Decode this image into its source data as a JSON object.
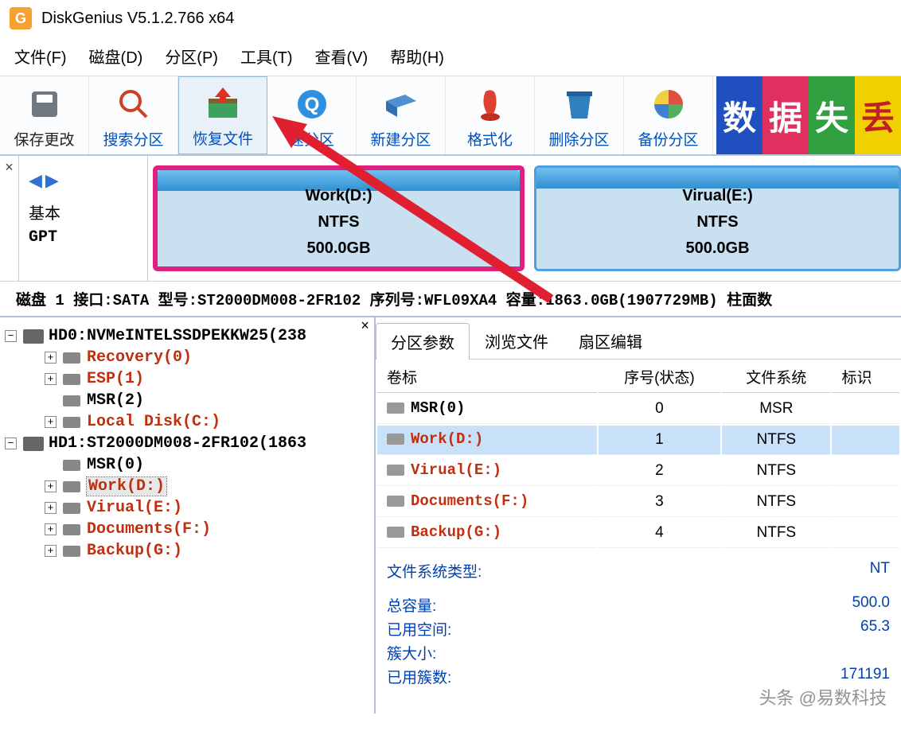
{
  "title": "DiskGenius V5.1.2.766 x64",
  "menu": [
    "文件(F)",
    "磁盘(D)",
    "分区(P)",
    "工具(T)",
    "查看(V)",
    "帮助(H)"
  ],
  "toolbar": [
    "保存更改",
    "搜索分区",
    "恢复文件",
    "速分区",
    "新建分区",
    "格式化",
    "删除分区",
    "备份分区"
  ],
  "ad": [
    "数",
    "据",
    "失",
    "丢"
  ],
  "nav": {
    "basic": "基本",
    "gpt": "GPT"
  },
  "partitions": [
    {
      "name": "Work(D:)",
      "fs": "NTFS",
      "size": "500.0GB",
      "selected": true
    },
    {
      "name": "Virual(E:)",
      "fs": "NTFS",
      "size": "500.0GB",
      "selected": false
    }
  ],
  "infobar": "磁盘 1  接口:SATA  型号:ST2000DM008-2FR102  序列号:WFL09XA4  容量:1863.0GB(1907729MB)  柱面数",
  "tree": {
    "hd0": "HD0:NVMeINTELSSDPEKKW25(238",
    "hd0_items": [
      {
        "label": "Recovery(0)",
        "red": true
      },
      {
        "label": "ESP(1)",
        "red": true
      },
      {
        "label": "MSR(2)",
        "red": false,
        "noexpand": true
      },
      {
        "label": "Local Disk(C:)",
        "red": true
      }
    ],
    "hd1": "HD1:ST2000DM008-2FR102(1863",
    "hd1_items": [
      {
        "label": "MSR(0)",
        "red": false,
        "noexpand": true
      },
      {
        "label": "Work(D:)",
        "red": true,
        "selected": true
      },
      {
        "label": "Virual(E:)",
        "red": true
      },
      {
        "label": "Documents(F:)",
        "red": true
      },
      {
        "label": "Backup(G:)",
        "red": true
      }
    ]
  },
  "tabs": [
    "分区参数",
    "浏览文件",
    "扇区编辑"
  ],
  "columns": [
    "卷标",
    "序号(状态)",
    "文件系统",
    "标识"
  ],
  "rows": [
    {
      "name": "MSR(0)",
      "idx": "0",
      "fs": "MSR",
      "red": false
    },
    {
      "name": "Work(D:)",
      "idx": "1",
      "fs": "NTFS",
      "red": true,
      "selected": true
    },
    {
      "name": "Virual(E:)",
      "idx": "2",
      "fs": "NTFS",
      "red": true
    },
    {
      "name": "Documents(F:)",
      "idx": "3",
      "fs": "NTFS",
      "red": true
    },
    {
      "name": "Backup(G:)",
      "idx": "4",
      "fs": "NTFS",
      "red": true
    }
  ],
  "details": {
    "fstype_label": "文件系统类型:",
    "fstype": "NT",
    "rows": [
      {
        "k": "总容量:",
        "v": "500.0"
      },
      {
        "k": "已用空间:",
        "v": "65.3"
      },
      {
        "k": "簇大小:",
        "v": ""
      },
      {
        "k": "已用簇数:",
        "v": "171191"
      }
    ]
  },
  "watermark": "头条 @易数科技"
}
